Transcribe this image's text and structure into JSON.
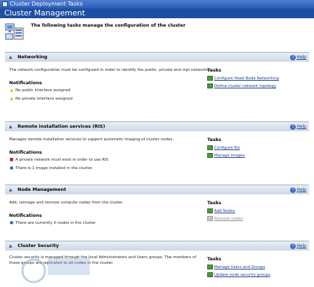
{
  "window": {
    "title": "Cluster Deployment Tasks"
  },
  "header": {
    "title": "Cluster Management"
  },
  "intro": {
    "text": "The following tasks manage the configuration of the cluster"
  },
  "help_label": "Help",
  "sections": [
    {
      "title": "Networking",
      "description": "The network configuration must be configured in order to identify the public, private and mpi networks.",
      "notifications_label": "Notifications",
      "notifications": [
        {
          "icon": "warning-icon",
          "text": "No public interface assigned"
        },
        {
          "icon": "warning-icon",
          "text": "No private interface assigned"
        }
      ],
      "tasks_label": "Tasks",
      "tasks": [
        {
          "label": "Configure Head Node Networking",
          "enabled": true
        },
        {
          "label": "Define cluster network topology",
          "enabled": true
        }
      ]
    },
    {
      "title": "Remote installation services (RIS)",
      "description": "Manages remote installation services to support automatic imaging of cluster nodes.",
      "notifications_label": "Notifications",
      "notifications": [
        {
          "icon": "error-icon",
          "text": "A private network must exist in order to use RIS"
        },
        {
          "icon": "info-icon",
          "text": "There is 1 image installed in the cluster."
        }
      ],
      "tasks_label": "Tasks",
      "tasks": [
        {
          "label": "Configure Ris",
          "enabled": true
        },
        {
          "label": "Manage Images",
          "enabled": true
        }
      ]
    },
    {
      "title": "Node Management",
      "description": "Add, reimage and remove compute nodes from the cluster",
      "notifications_label": "Notifications",
      "notifications": [
        {
          "icon": "info-icon",
          "text": "There are currently 0 nodes in the cluster"
        }
      ],
      "tasks_label": "Tasks",
      "tasks": [
        {
          "label": "Add Nodes",
          "enabled": true
        },
        {
          "label": "Remove nodes",
          "enabled": false
        }
      ]
    },
    {
      "title": "Cluster Security",
      "description": "Cluster security is managed through the local Administrators and Users groups. The members of these groups are replicated to all nodes in the cluster.",
      "tasks_label": "Tasks",
      "tasks": [
        {
          "label": "Manage Users and Groups",
          "enabled": true
        },
        {
          "label": "Update node security groups",
          "enabled": true
        }
      ]
    }
  ],
  "colors": {
    "header_blue": "#1d4fa3",
    "link_blue": "#1a3e8a",
    "section_header": "#d6dfeb",
    "warning": "#e8b800",
    "error": "#c62020",
    "info": "#2a5fb5"
  }
}
